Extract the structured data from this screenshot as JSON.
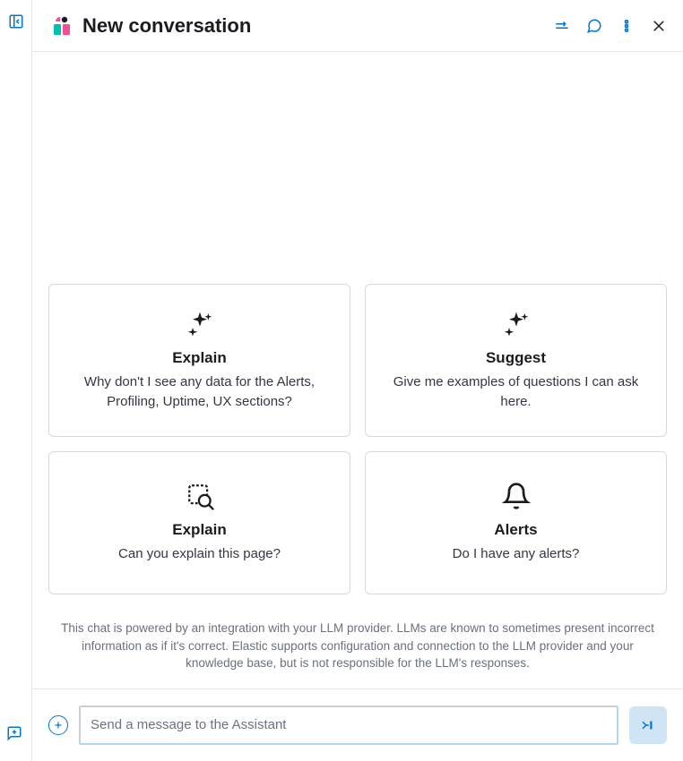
{
  "header": {
    "title": "New conversation"
  },
  "cards": [
    {
      "title": "Explain",
      "desc": "Why don't I see any data for the Alerts, Profiling, Uptime, UX sections?"
    },
    {
      "title": "Suggest",
      "desc": "Give me examples of questions I can ask here."
    },
    {
      "title": "Explain",
      "desc": "Can you explain this page?"
    },
    {
      "title": "Alerts",
      "desc": "Do I have any alerts?"
    }
  ],
  "disclaimer": "This chat is powered by an integration with your LLM provider. LLMs are known to sometimes present incorrect information as if it's correct. Elastic supports configuration and connection to the LLM provider and your knowledge base, but is not responsible for the LLM's responses.",
  "input": {
    "placeholder": "Send a message to the Assistant"
  }
}
